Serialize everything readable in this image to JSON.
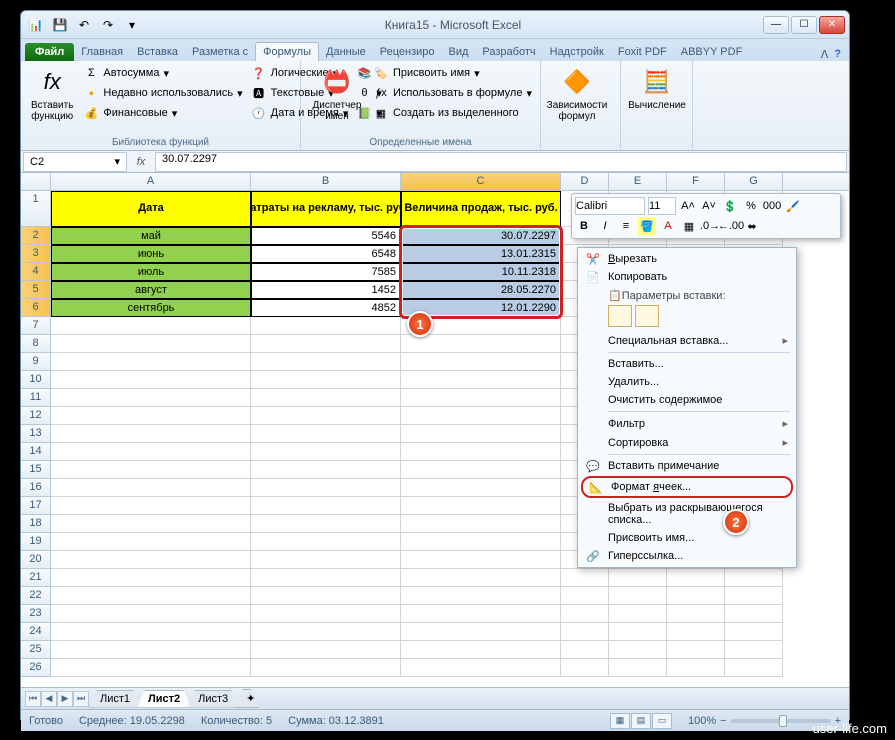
{
  "title": "Книга15 - Microsoft Excel",
  "qat": {
    "save": "💾",
    "undo": "↶",
    "redo": "↷"
  },
  "wc": {
    "min": "—",
    "max": "☐",
    "close": "✕"
  },
  "tabs": {
    "file": "Файл",
    "list": [
      "Главная",
      "Вставка",
      "Разметка с",
      "Формулы",
      "Данные",
      "Рецензиро",
      "Вид",
      "Разработч",
      "Надстройк",
      "Foxit PDF",
      "ABBYY PDF"
    ],
    "active": 3
  },
  "ribbon": {
    "g1": {
      "big": "Вставить\nфункцию",
      "items": [
        "Автосумма",
        "Недавно использовались",
        "Финансовые"
      ],
      "label": "Библиотека функций"
    },
    "g2": {
      "items": [
        "Логические",
        "Текстовые",
        "Дата и время"
      ]
    },
    "g3": {
      "big": "Диспетчер\nимен",
      "items": [
        "Присвоить имя",
        "Использовать в формуле",
        "Создать из выделенного"
      ],
      "label": "Определенные имена"
    },
    "g4": {
      "big": "Зависимости\nформул"
    },
    "g5": {
      "big": "Вычисление"
    }
  },
  "namebox": "C2",
  "formula": "30.07.2297",
  "cols": [
    "A",
    "B",
    "C",
    "D",
    "E",
    "F",
    "G"
  ],
  "headers": {
    "A": "Дата",
    "B": "Затраты на рекламу, тыс. руб.",
    "C": "Величина продаж, тыс. руб."
  },
  "data": [
    {
      "r": 2,
      "A": "май",
      "B": "5546",
      "C": "30.07.2297"
    },
    {
      "r": 3,
      "A": "июнь",
      "B": "6548",
      "C": "13.01.2315"
    },
    {
      "r": 4,
      "A": "июль",
      "B": "7585",
      "C": "10.11.2318"
    },
    {
      "r": 5,
      "A": "август",
      "B": "1452",
      "C": "28.05.2270"
    },
    {
      "r": 6,
      "A": "сентябрь",
      "B": "4852",
      "C": "12.01.2290"
    }
  ],
  "empty_rows": [
    7,
    8,
    9,
    10,
    11,
    12,
    13,
    14,
    15,
    16,
    17,
    18,
    19,
    20,
    21,
    22,
    23,
    24,
    25,
    26
  ],
  "minitb": {
    "font": "Calibri",
    "size": "11"
  },
  "ctx": {
    "cut": "Вырезать",
    "copy": "Копировать",
    "pasteopts": "Параметры вставки:",
    "spaste": "Специальная вставка...",
    "insert": "Вставить...",
    "delete": "Удалить...",
    "clear": "Очистить содержимое",
    "filter": "Фильтр",
    "sort": "Сортировка",
    "comment": "Вставить примечание",
    "format": "Формат ячеек...",
    "dropdown": "Выбрать из раскрывающегося списка...",
    "name": "Присвоить имя...",
    "link": "Гиперссылка..."
  },
  "sheets": {
    "list": [
      "Лист1",
      "Лист2",
      "Лист3"
    ],
    "active": 1
  },
  "status": {
    "ready": "Готово",
    "avg": "Среднее: 19.05.2298",
    "count": "Количество: 5",
    "sum": "Сумма: 03.12.3891",
    "zoom": "100%"
  },
  "callouts": {
    "c1": "1",
    "c2": "2"
  },
  "watermark": "user-life.com"
}
